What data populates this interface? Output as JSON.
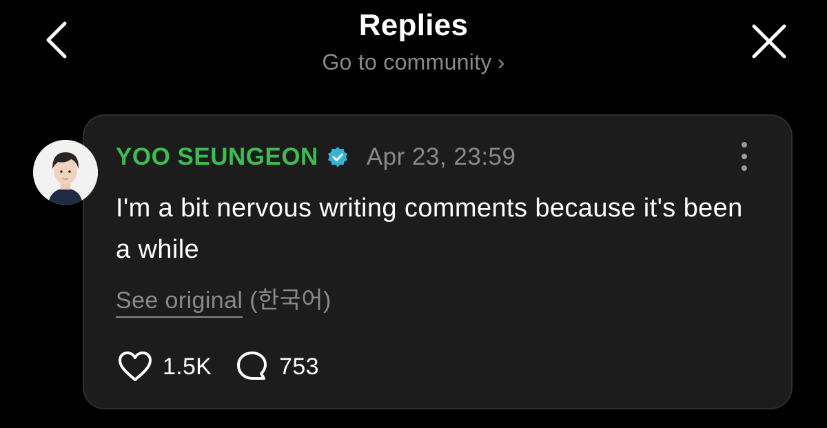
{
  "header": {
    "title": "Replies",
    "community_link": "Go to community",
    "community_chevron": "›"
  },
  "post": {
    "author": "YOO SEUNGEON",
    "timestamp": "Apr 23, 23:59",
    "text": "I'm a bit nervous writing comments because it's been a while",
    "see_original": "See original",
    "original_language": "(한국어)",
    "likes": "1.5K",
    "comments": "753"
  },
  "icons": {
    "back": "chevron-left-icon",
    "close": "close-icon",
    "verified": "verified-badge-icon",
    "more": "more-vertical-icon",
    "like": "heart-icon",
    "comment": "comment-bubble-icon"
  },
  "colors": {
    "background": "#000000",
    "card": "#1c1c1c",
    "author_green": "#3ebd4f",
    "verified_teal": "#36b3d6",
    "muted": "#8a8a8a"
  }
}
